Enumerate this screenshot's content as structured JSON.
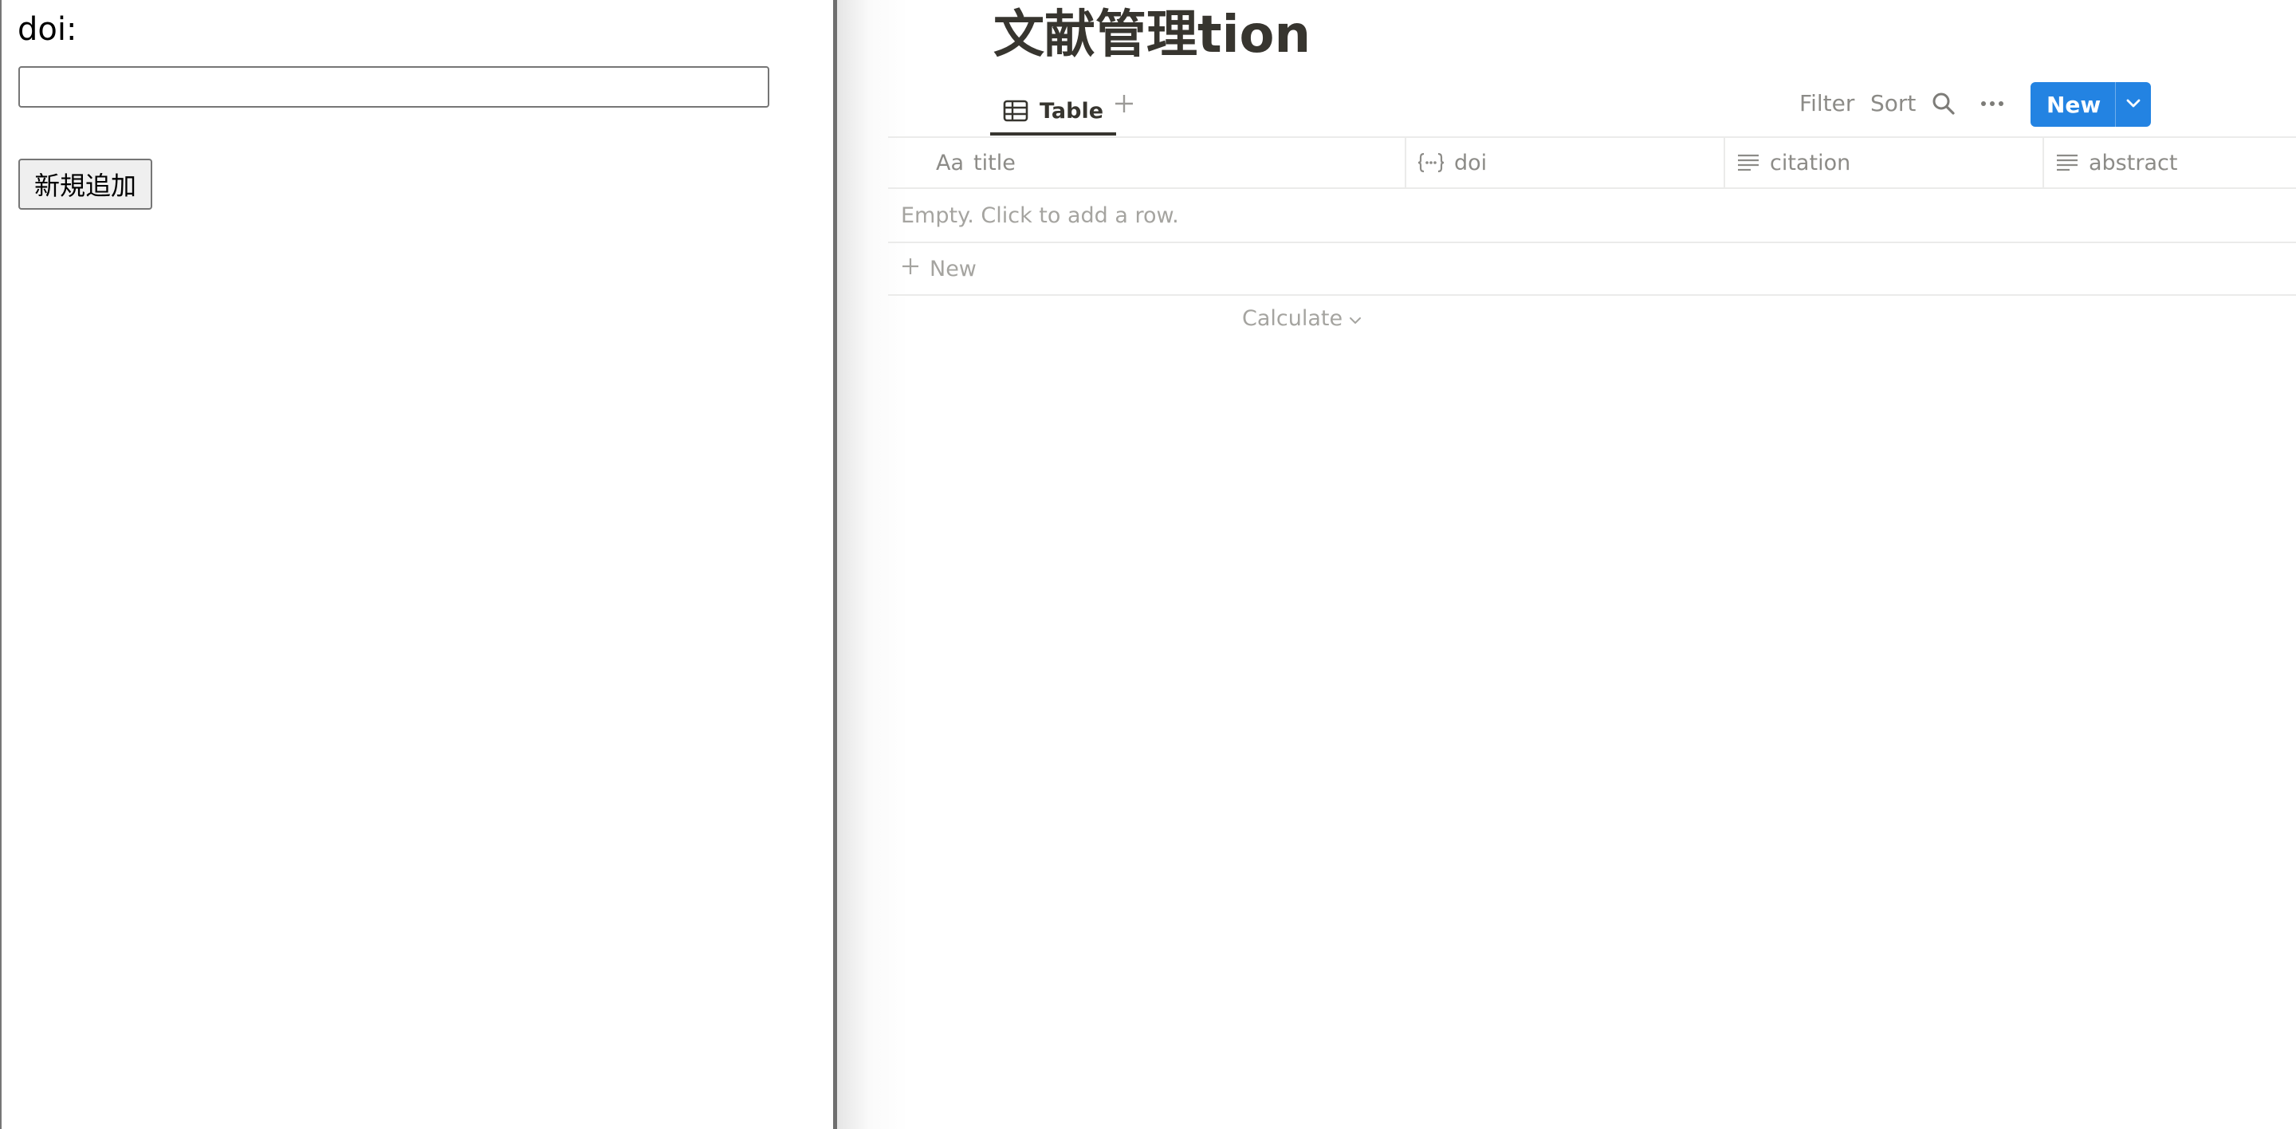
{
  "left_pane": {
    "doi_label": "doi:",
    "doi_input_value": "",
    "add_button_label": "新規追加"
  },
  "database": {
    "title": "文献管理tion",
    "view_tab_label": "Table",
    "toolbar": {
      "filter_label": "Filter",
      "sort_label": "Sort",
      "new_label": "New",
      "icons": [
        "search-icon",
        "more-icon",
        "chevron-down-icon"
      ]
    },
    "columns": [
      {
        "icon_text": "Aa",
        "label": "title",
        "icon": "text-title-icon"
      },
      {
        "label": "doi",
        "icon": "formula-icon"
      },
      {
        "label": "citation",
        "icon": "text-lines-icon"
      },
      {
        "label": "abstract",
        "icon": "text-lines-icon"
      }
    ],
    "empty_message": "Empty. Click to add a row.",
    "new_row_label": "New",
    "calculate_label": "Calculate"
  },
  "colors": {
    "accent": "#2383e2",
    "text": "#37352f",
    "muted": "#8c8b87",
    "border": "#ebebea"
  }
}
